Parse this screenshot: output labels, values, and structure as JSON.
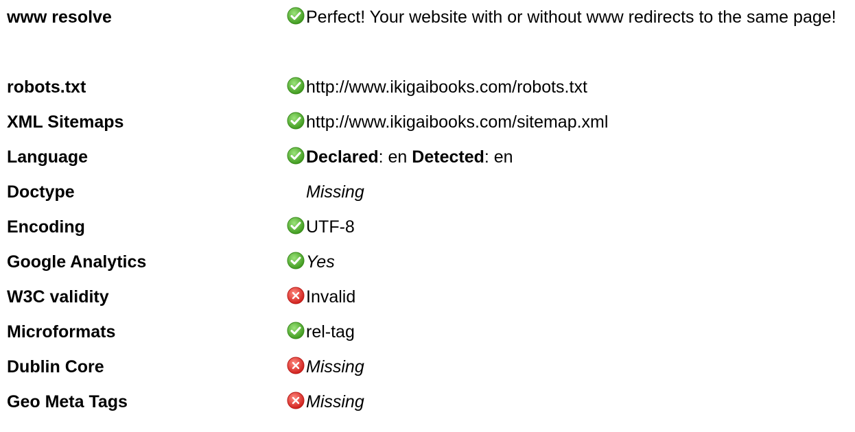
{
  "rows": [
    {
      "label": "www resolve",
      "status": "ok",
      "value": "Perfect! Your website with or without www redirects to the same page!"
    },
    {
      "label": "robots.txt",
      "status": "ok",
      "value": "http://www.ikigaibooks.com/robots.txt"
    },
    {
      "label": "XML Sitemaps",
      "status": "ok",
      "value": "http://www.ikigaibooks.com/sitemap.xml"
    },
    {
      "label": "Language",
      "status": "ok",
      "declared_label": "Declared",
      "declared_value": ": en",
      "detected_label": "Detected",
      "detected_value": ": en"
    },
    {
      "label": "Doctype",
      "status": "none",
      "value": "Missing"
    },
    {
      "label": "Encoding",
      "status": "ok",
      "value": "UTF-8"
    },
    {
      "label": "Google Analytics",
      "status": "ok",
      "value": "Yes"
    },
    {
      "label": "W3C validity",
      "status": "error",
      "value": "Invalid"
    },
    {
      "label": "Microformats",
      "status": "ok",
      "value": "rel-tag"
    },
    {
      "label": "Dublin Core",
      "status": "error",
      "value": "Missing"
    },
    {
      "label": "Geo Meta Tags",
      "status": "error",
      "value": "Missing"
    }
  ],
  "colors": {
    "ok": "#4caf2a",
    "error": "#e0302c"
  }
}
